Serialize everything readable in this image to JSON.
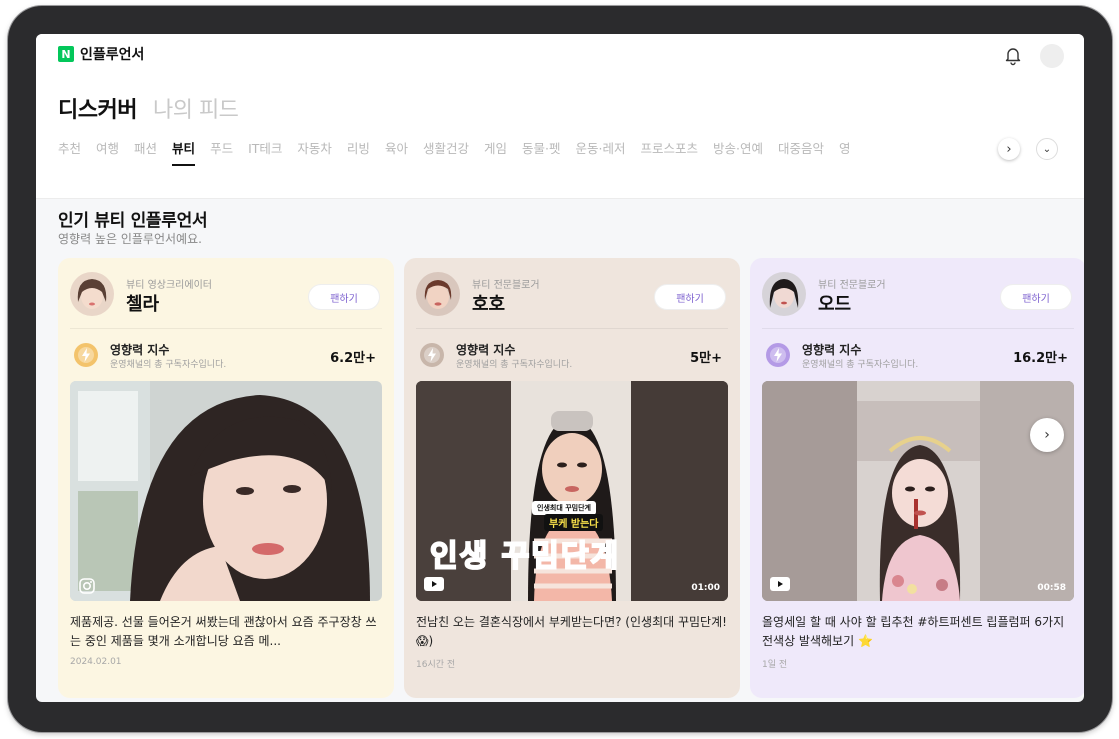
{
  "brand": {
    "logo_letter": "N",
    "name": "인플루언서"
  },
  "hero_tabs": [
    {
      "label": "디스커버",
      "active": true
    },
    {
      "label": "나의 피드",
      "active": false
    }
  ],
  "categories": [
    {
      "label": "추천",
      "active": false
    },
    {
      "label": "여행",
      "active": false
    },
    {
      "label": "패션",
      "active": false
    },
    {
      "label": "뷰티",
      "active": true
    },
    {
      "label": "푸드",
      "active": false
    },
    {
      "label": "IT테크",
      "active": false
    },
    {
      "label": "자동차",
      "active": false
    },
    {
      "label": "리빙",
      "active": false
    },
    {
      "label": "육아",
      "active": false
    },
    {
      "label": "생활건강",
      "active": false
    },
    {
      "label": "게임",
      "active": false
    },
    {
      "label": "동물·펫",
      "active": false
    },
    {
      "label": "운동·레저",
      "active": false
    },
    {
      "label": "프로스포츠",
      "active": false
    },
    {
      "label": "방송·연예",
      "active": false
    },
    {
      "label": "대중음악",
      "active": false
    },
    {
      "label": "영",
      "active": false
    }
  ],
  "section": {
    "title": "인기 뷰티 인플루언서",
    "subtitle": "영향력 높은 인플루언서예요."
  },
  "cards": [
    {
      "role": "뷰티 영상크리에이터",
      "nickname": "첼라",
      "follow_label": "팬하기",
      "metric_label": "영향력 지수",
      "metric_desc": "운영채널의 총 구독자수입니다.",
      "metric_value": "6.2만+",
      "media_type": "instagram",
      "duration": "",
      "caption": "제품제공. 선물 들어온거 써봤는데 괜찮아서 요즘 주구장창 쓰는 중인 제품들 몇개 소개합니당 요즘 메...",
      "date": "2024.02.01",
      "accent": "#f3c36b"
    },
    {
      "role": "뷰티 전문블로거",
      "nickname": "호호",
      "follow_label": "팬하기",
      "metric_label": "영향력 지수",
      "metric_desc": "운영채널의 총 구독자수입니다.",
      "metric_value": "5만+",
      "media_type": "youtube",
      "duration": "01:00",
      "caption": "전남친 오는 결혼식장에서 부케받는다면? (인생최대 꾸밈단계!😱)",
      "date": "16시간 전",
      "accent": "#c8b6aa"
    },
    {
      "role": "뷰티 전문블로거",
      "nickname": "오드",
      "follow_label": "팬하기",
      "metric_label": "영향력 지수",
      "metric_desc": "운영채널의 총 구독자수입니다.",
      "metric_value": "16.2만+",
      "media_type": "youtube",
      "duration": "00:58",
      "caption": "올영세일 할 때 사야 할 립추천 #하트퍼센트 립플럼퍼 6가지 전색상 발색해보기 ⭐",
      "date": "1일 전",
      "accent": "#b49ae6"
    }
  ],
  "video_overlay": {
    "small_banner": "인생최대 꾸밈단계",
    "big_text": "인생 꾸밈단계",
    "bouquet": "부케 받는다"
  },
  "icons": {
    "bell": "bell-icon",
    "next": "chevron-right-icon",
    "expand": "chevron-down-icon",
    "metric": "bolt-icon",
    "instagram": "instagram-icon",
    "youtube": "youtube-icon"
  }
}
